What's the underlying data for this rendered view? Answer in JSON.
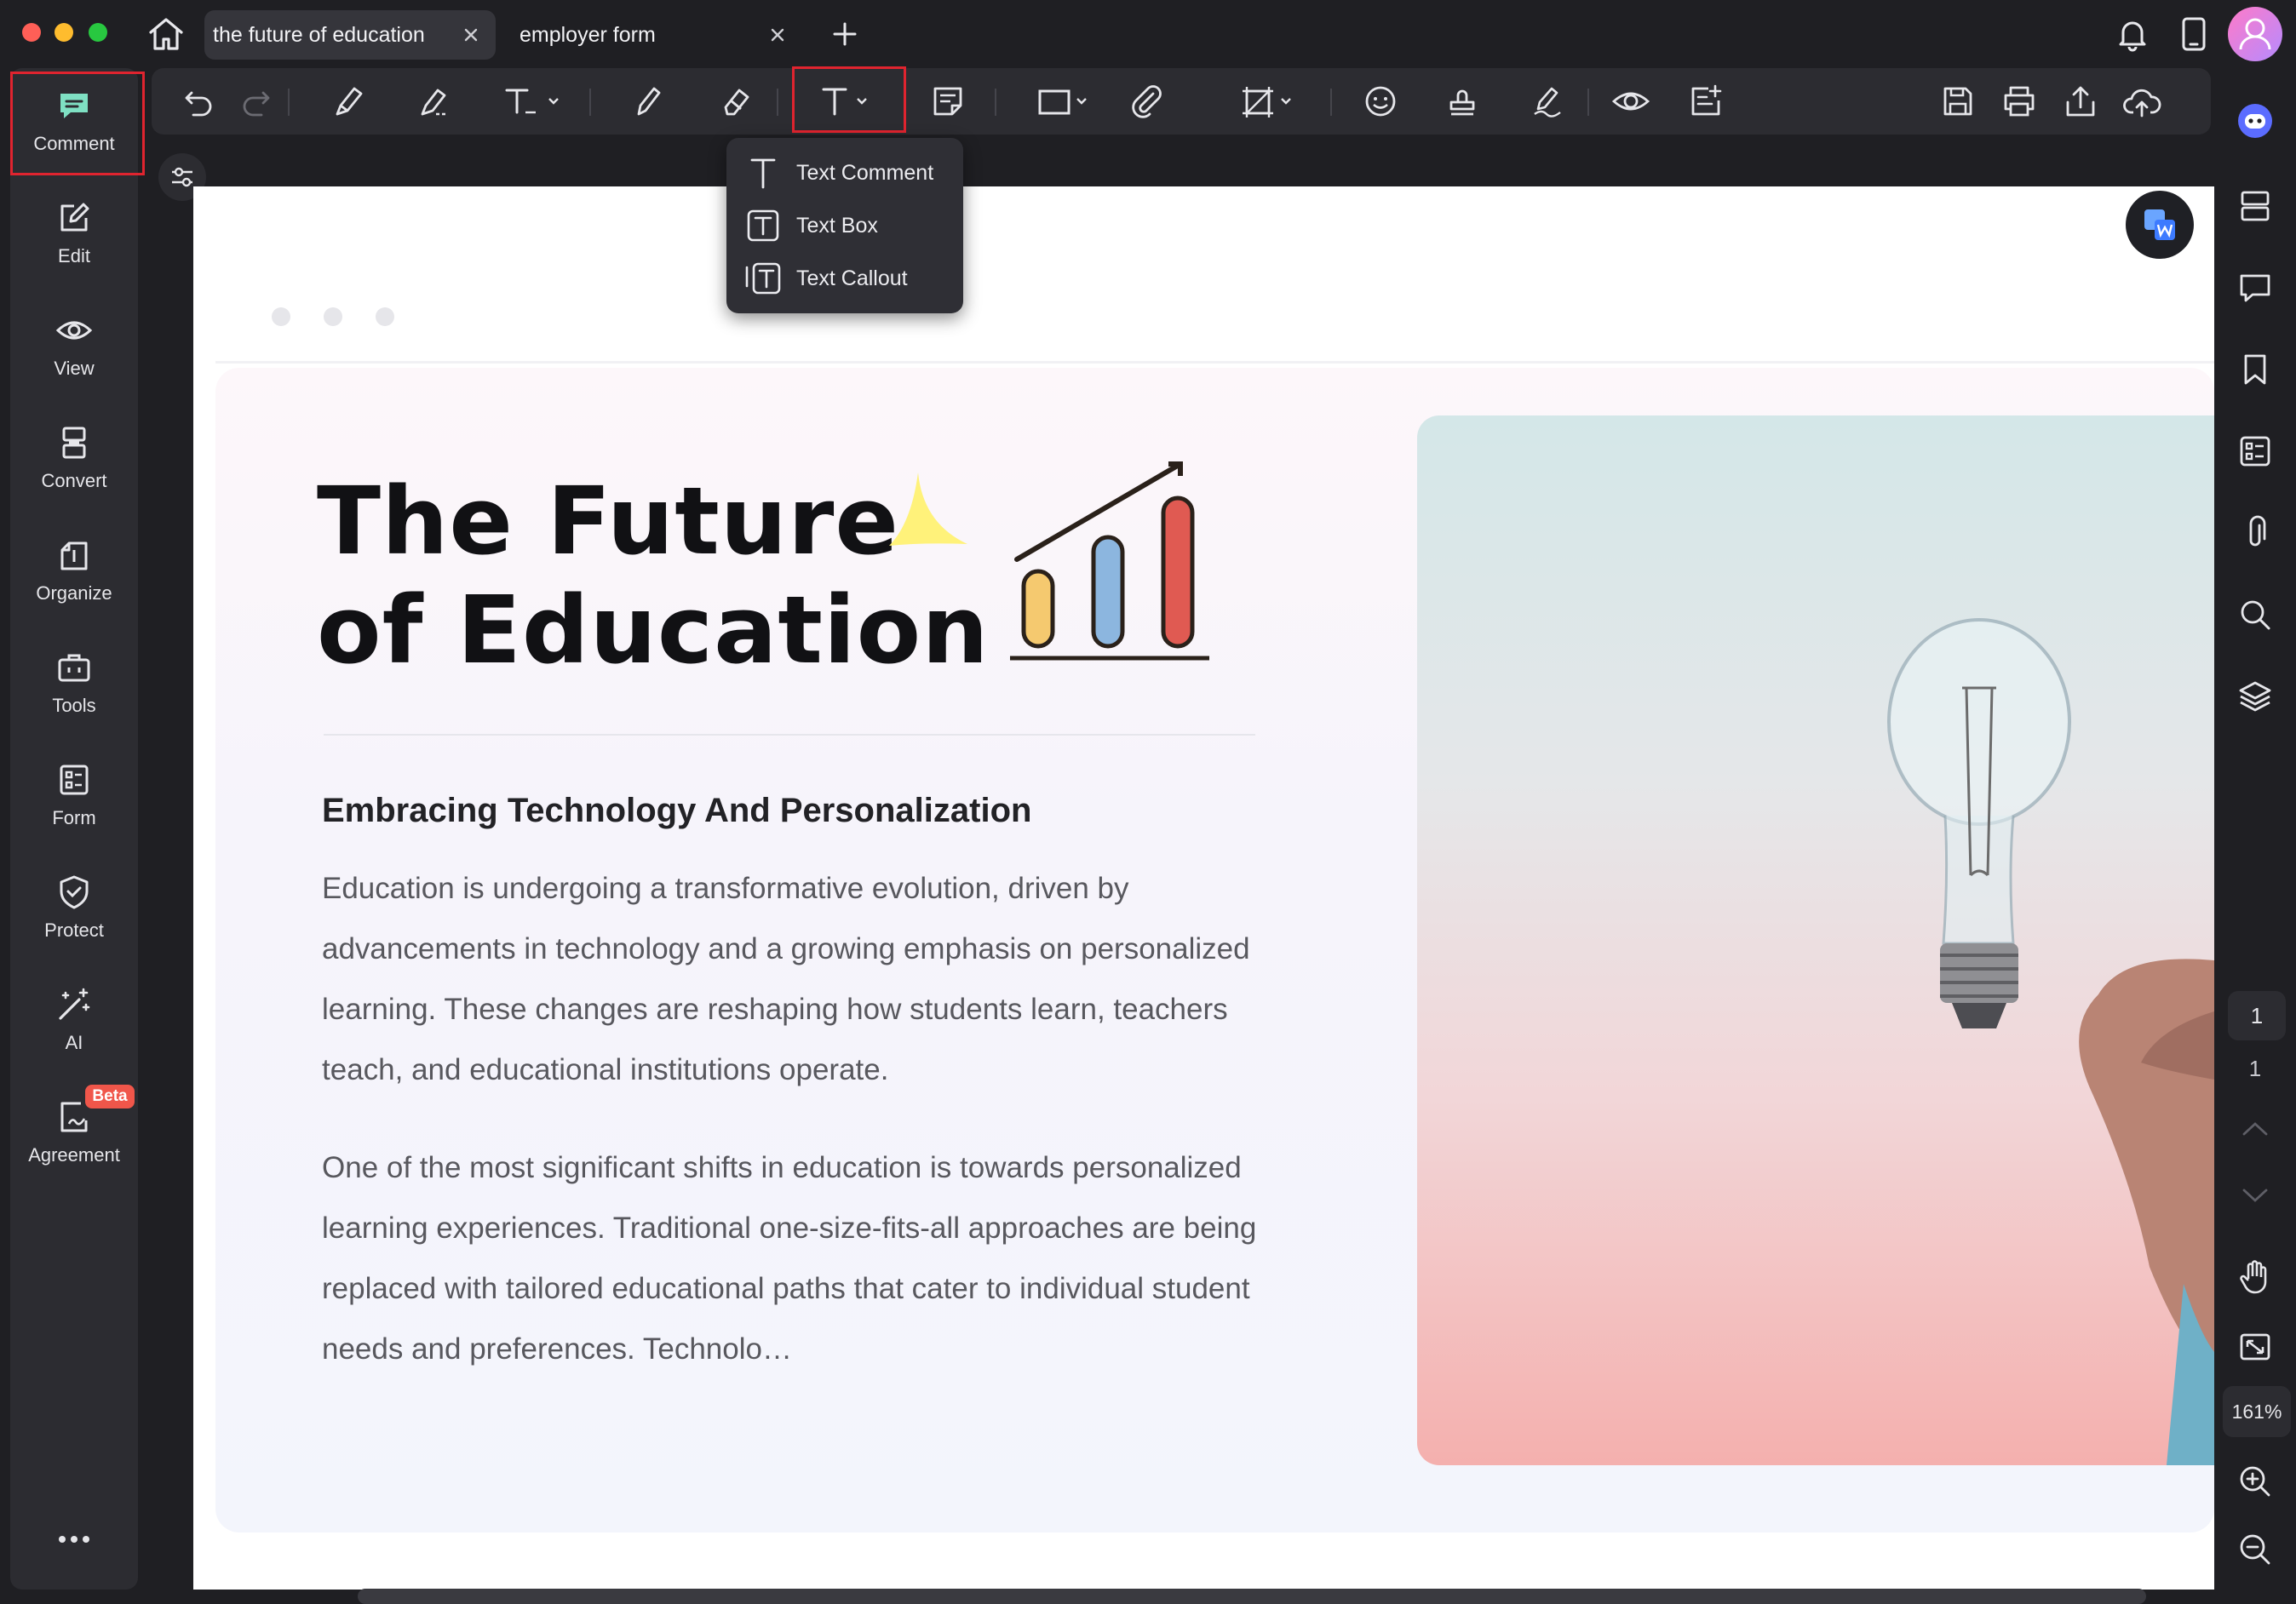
{
  "tabs": [
    {
      "label": "the future of education",
      "active": true
    },
    {
      "label": "employer form",
      "active": false
    }
  ],
  "left_nav": [
    {
      "label": "Comment",
      "icon": "comment-icon",
      "active": true
    },
    {
      "label": "Edit",
      "icon": "edit-icon"
    },
    {
      "label": "View",
      "icon": "view-icon"
    },
    {
      "label": "Convert",
      "icon": "convert-icon"
    },
    {
      "label": "Organize",
      "icon": "organize-icon"
    },
    {
      "label": "Tools",
      "icon": "tools-icon"
    },
    {
      "label": "Form",
      "icon": "form-icon"
    },
    {
      "label": "Protect",
      "icon": "protect-icon"
    },
    {
      "label": "AI",
      "icon": "ai-wand-icon"
    },
    {
      "label": "Agreement",
      "icon": "agreement-icon",
      "badge": "Beta"
    }
  ],
  "text_menu": {
    "items": [
      {
        "label": "Text Comment",
        "icon": "text-comment-icon"
      },
      {
        "label": "Text Box",
        "icon": "text-box-icon"
      },
      {
        "label": "Text Callout",
        "icon": "text-callout-icon"
      }
    ]
  },
  "document": {
    "title_line1": "The Future",
    "title_line2": "of Education",
    "subheading": "Embracing Technology And Personalization",
    "paragraph1": "Education is undergoing a transformative evolution, driven by advancements in technology and a growing emphasis on personalized learning. These changes are reshaping how students learn, teachers teach, and educational institutions operate.",
    "paragraph2": "One of the most significant shifts in education is towards personalized learning experiences. Traditional one-size-fits-all approaches are being replaced with tailored educational paths that cater to individual student needs and preferences. Technolo…"
  },
  "page_nav": {
    "current_page": "1",
    "total_pages": "1",
    "zoom": "161%"
  },
  "colors": {
    "accent_red": "#e0242f",
    "comment_icon": "#7fe0c3",
    "beta_badge": "#f0564a"
  }
}
